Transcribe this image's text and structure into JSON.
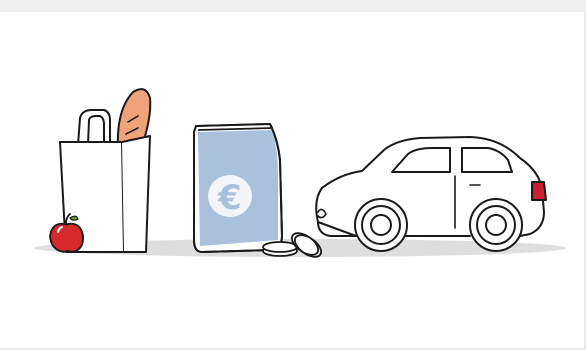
{
  "illustration": {
    "items": [
      {
        "name": "shopping-bag",
        "contents": [
          "baguette",
          "apple"
        ]
      },
      {
        "name": "money-pouch",
        "symbol": "€"
      },
      {
        "name": "coins"
      },
      {
        "name": "car"
      }
    ]
  },
  "pouch": {
    "symbol": "€"
  },
  "colors": {
    "outline": "#1a1a1a",
    "pouch_fill": "#a9c1dd",
    "bread": "#f0a37a",
    "apple": "#d7282b",
    "taillight": "#c91f2f",
    "shadow": "#dcdcdc",
    "strip": "#f0f0f0"
  }
}
